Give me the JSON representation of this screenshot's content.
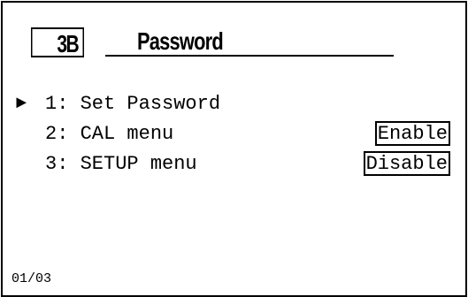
{
  "header": {
    "menu_code": "3B",
    "title": "Password"
  },
  "menu": {
    "cursor": "►",
    "items": [
      {
        "label": "1: Set Password",
        "status": ""
      },
      {
        "label": "2: CAL menu",
        "status": "Enable"
      },
      {
        "label": "3: SETUP menu",
        "status": "Disable"
      }
    ]
  },
  "footer": {
    "page_indicator": "01/03"
  }
}
